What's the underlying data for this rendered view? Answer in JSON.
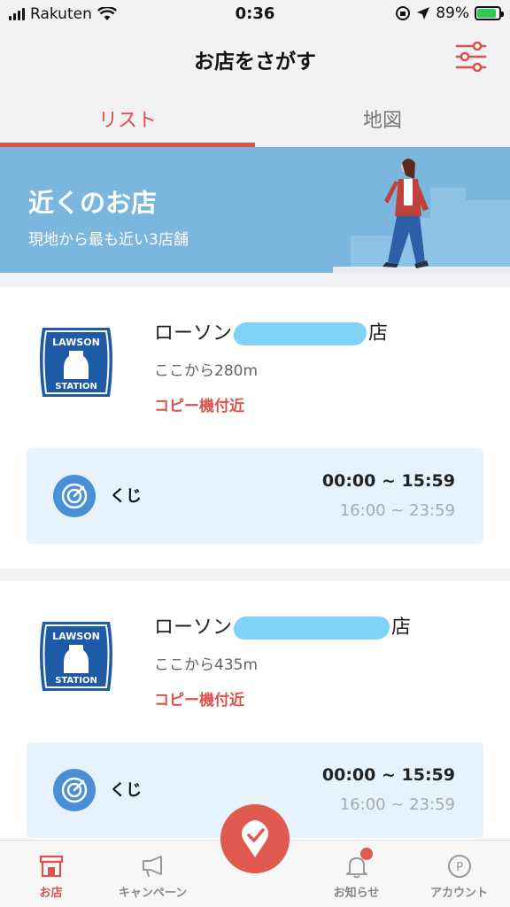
{
  "status_bar": {
    "carrier": "Rakuten",
    "time": "0:36",
    "battery_percent": "89%",
    "battery_level": 0.89
  },
  "header": {
    "title": "お店をさがす"
  },
  "tabs": [
    {
      "label": "リスト",
      "active": true
    },
    {
      "label": "地図",
      "active": false
    }
  ],
  "banner": {
    "title": "近くのお店",
    "subtitle": "現地から最も近い3店舗"
  },
  "stores": [
    {
      "name_prefix": "ローソン",
      "name_suffix": "店",
      "distance": "ここから280m",
      "note": "コピー機付近",
      "service": {
        "label": "くじ",
        "time_active": "00:00 ~ 15:59",
        "time_inactive": "16:00 ~ 23:59"
      }
    },
    {
      "name_prefix": "ローソン",
      "name_suffix": "店",
      "distance": "ここから435m",
      "note": "コピー機付近",
      "service": {
        "label": "くじ",
        "time_active": "00:00 ~ 15:59",
        "time_inactive": "16:00 ~ 23:59"
      }
    }
  ],
  "logo": {
    "top": "LAWSON",
    "bottom": "STATION"
  },
  "bottom_nav": {
    "home": "お店",
    "campaign": "キャンペーン",
    "news": "お知らせ",
    "account": "アカウント"
  },
  "colors": {
    "accent": "#d9534f",
    "banner": "#7ab6de",
    "service_bg": "#e7f3fc",
    "logo_blue": "#1f5aa6"
  }
}
